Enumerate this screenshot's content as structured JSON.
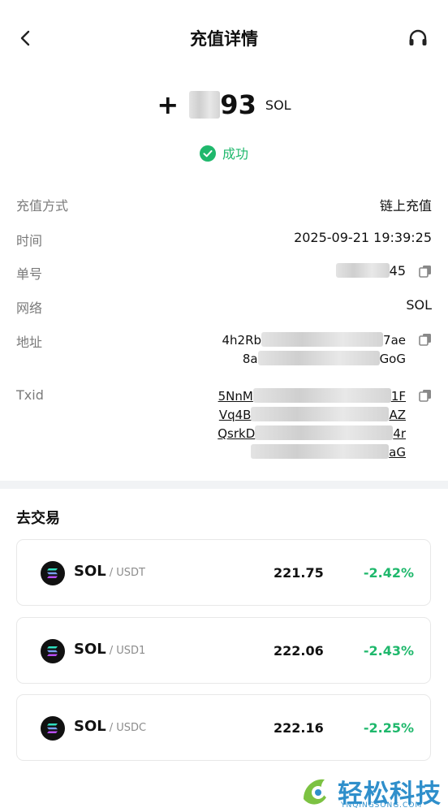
{
  "header": {
    "title": "充值详情",
    "back_icon": "chevron-left-icon",
    "support_icon": "headset-icon"
  },
  "amount": {
    "sign": "+",
    "visible_digits": "93",
    "unit": "SOL"
  },
  "status": {
    "text": "成功",
    "color": "#1fb86c"
  },
  "details": [
    {
      "label": "充值方式",
      "value": "链上充值"
    },
    {
      "label": "时间",
      "value": "2025-09-21 19:39:25"
    },
    {
      "label": "单号",
      "value_suffix": "45"
    },
    {
      "label": "网络",
      "value": "SOL"
    },
    {
      "label": "地址",
      "line1_start": "4h2Rb",
      "line1_end": "7ae",
      "line2_start": "8a",
      "line2_end": "GoG"
    },
    {
      "label": "Txid",
      "lines": [
        {
          "start": "5NnM",
          "end": "1F"
        },
        {
          "start": "Vq4B",
          "end": "AZ"
        },
        {
          "start": "QsrkD",
          "end": "4r"
        },
        {
          "start": "",
          "end": "aG"
        }
      ]
    }
  ],
  "trade": {
    "title": "去交易",
    "pairs": [
      {
        "base": "SOL",
        "quote": "/ USDT",
        "price": "221.75",
        "change": "-2.42%"
      },
      {
        "base": "SOL",
        "quote": "/ USD1",
        "price": "222.06",
        "change": "-2.43%"
      },
      {
        "base": "SOL",
        "quote": "/ USDC",
        "price": "222.16",
        "change": "-2.25%"
      }
    ]
  },
  "watermark": {
    "text": "轻松科技",
    "sub": "YNQINGSONG.COM"
  }
}
